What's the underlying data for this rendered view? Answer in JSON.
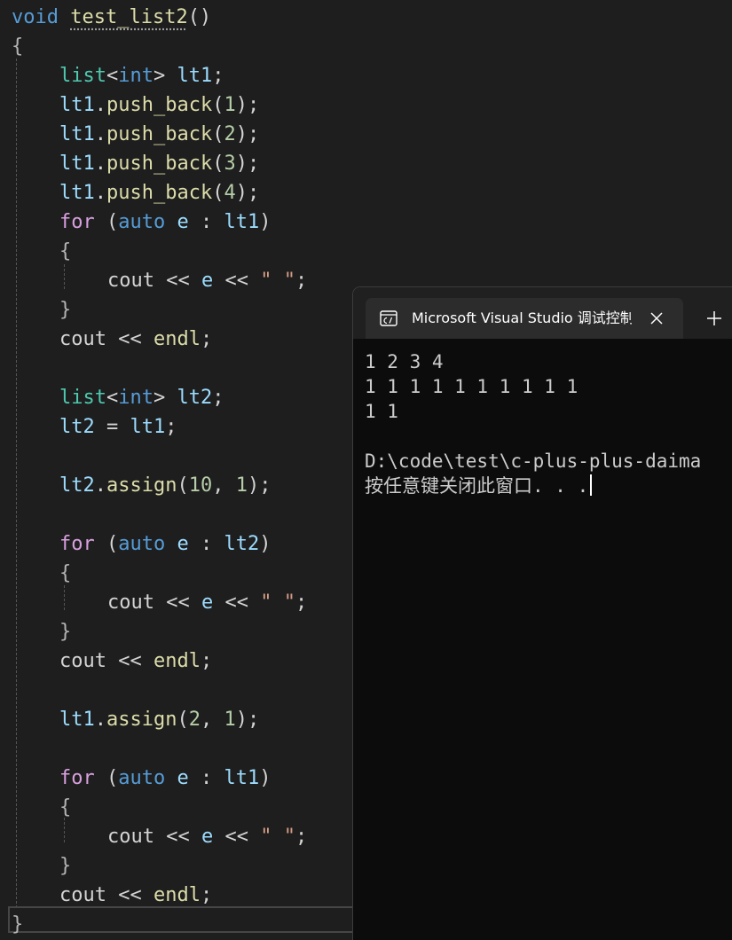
{
  "code": {
    "lines": [
      {
        "indent": 0,
        "tokens": [
          {
            "t": "void",
            "c": "kw"
          },
          {
            "t": " ",
            "c": "punc"
          },
          {
            "t": "test_list2",
            "c": "fn",
            "d": true
          },
          {
            "t": "()",
            "c": "punc"
          }
        ]
      },
      {
        "indent": 0,
        "tokens": [
          {
            "t": "{",
            "c": "brace"
          }
        ]
      },
      {
        "indent": 1,
        "tokens": [
          {
            "t": "list",
            "c": "type"
          },
          {
            "t": "<",
            "c": "punc"
          },
          {
            "t": "int",
            "c": "kw"
          },
          {
            "t": ">",
            "c": "punc"
          },
          {
            "t": " lt1",
            "c": "var"
          },
          {
            "t": ";",
            "c": "punc"
          }
        ]
      },
      {
        "indent": 1,
        "tokens": [
          {
            "t": "lt1",
            "c": "var"
          },
          {
            "t": ".",
            "c": "punc"
          },
          {
            "t": "push_back",
            "c": "fn"
          },
          {
            "t": "(",
            "c": "punc"
          },
          {
            "t": "1",
            "c": "num"
          },
          {
            "t": ");",
            "c": "punc"
          }
        ]
      },
      {
        "indent": 1,
        "tokens": [
          {
            "t": "lt1",
            "c": "var"
          },
          {
            "t": ".",
            "c": "punc"
          },
          {
            "t": "push_back",
            "c": "fn"
          },
          {
            "t": "(",
            "c": "punc"
          },
          {
            "t": "2",
            "c": "num"
          },
          {
            "t": ");",
            "c": "punc"
          }
        ]
      },
      {
        "indent": 1,
        "tokens": [
          {
            "t": "lt1",
            "c": "var"
          },
          {
            "t": ".",
            "c": "punc"
          },
          {
            "t": "push_back",
            "c": "fn"
          },
          {
            "t": "(",
            "c": "punc"
          },
          {
            "t": "3",
            "c": "num"
          },
          {
            "t": ");",
            "c": "punc"
          }
        ]
      },
      {
        "indent": 1,
        "tokens": [
          {
            "t": "lt1",
            "c": "var"
          },
          {
            "t": ".",
            "c": "punc"
          },
          {
            "t": "push_back",
            "c": "fn"
          },
          {
            "t": "(",
            "c": "punc"
          },
          {
            "t": "4",
            "c": "num"
          },
          {
            "t": ");",
            "c": "punc"
          }
        ]
      },
      {
        "indent": 1,
        "tokens": [
          {
            "t": "for",
            "c": "flow"
          },
          {
            "t": " (",
            "c": "punc"
          },
          {
            "t": "auto",
            "c": "kw"
          },
          {
            "t": " e ",
            "c": "var"
          },
          {
            "t": ": ",
            "c": "punc"
          },
          {
            "t": "lt1",
            "c": "var"
          },
          {
            "t": ")",
            "c": "punc"
          }
        ]
      },
      {
        "indent": 1,
        "tokens": [
          {
            "t": "{",
            "c": "brace"
          }
        ]
      },
      {
        "indent": 2,
        "tokens": [
          {
            "t": "cout",
            "c": "punc"
          },
          {
            "t": " << ",
            "c": "punc"
          },
          {
            "t": "e",
            "c": "var"
          },
          {
            "t": " << ",
            "c": "punc"
          },
          {
            "t": "\" \"",
            "c": "str"
          },
          {
            "t": ";",
            "c": "punc"
          }
        ]
      },
      {
        "indent": 1,
        "tokens": [
          {
            "t": "}",
            "c": "brace"
          }
        ]
      },
      {
        "indent": 1,
        "tokens": [
          {
            "t": "cout",
            "c": "punc"
          },
          {
            "t": " << ",
            "c": "punc"
          },
          {
            "t": "endl",
            "c": "fn"
          },
          {
            "t": ";",
            "c": "punc"
          }
        ]
      },
      {
        "indent": 0,
        "tokens": []
      },
      {
        "indent": 1,
        "tokens": [
          {
            "t": "list",
            "c": "type"
          },
          {
            "t": "<",
            "c": "punc"
          },
          {
            "t": "int",
            "c": "kw"
          },
          {
            "t": ">",
            "c": "punc"
          },
          {
            "t": " lt2",
            "c": "var"
          },
          {
            "t": ";",
            "c": "punc"
          }
        ]
      },
      {
        "indent": 1,
        "tokens": [
          {
            "t": "lt2",
            "c": "var"
          },
          {
            "t": " = ",
            "c": "punc"
          },
          {
            "t": "lt1",
            "c": "var"
          },
          {
            "t": ";",
            "c": "punc"
          }
        ]
      },
      {
        "indent": 0,
        "tokens": []
      },
      {
        "indent": 1,
        "tokens": [
          {
            "t": "lt2",
            "c": "var"
          },
          {
            "t": ".",
            "c": "punc"
          },
          {
            "t": "assign",
            "c": "fn"
          },
          {
            "t": "(",
            "c": "punc"
          },
          {
            "t": "10",
            "c": "num"
          },
          {
            "t": ", ",
            "c": "punc"
          },
          {
            "t": "1",
            "c": "num"
          },
          {
            "t": ");",
            "c": "punc"
          }
        ]
      },
      {
        "indent": 0,
        "tokens": []
      },
      {
        "indent": 1,
        "tokens": [
          {
            "t": "for",
            "c": "flow"
          },
          {
            "t": " (",
            "c": "punc"
          },
          {
            "t": "auto",
            "c": "kw"
          },
          {
            "t": " e ",
            "c": "var"
          },
          {
            "t": ": ",
            "c": "punc"
          },
          {
            "t": "lt2",
            "c": "var"
          },
          {
            "t": ")",
            "c": "punc"
          }
        ]
      },
      {
        "indent": 1,
        "tokens": [
          {
            "t": "{",
            "c": "brace"
          }
        ]
      },
      {
        "indent": 2,
        "tokens": [
          {
            "t": "cout",
            "c": "punc"
          },
          {
            "t": " << ",
            "c": "punc"
          },
          {
            "t": "e",
            "c": "var"
          },
          {
            "t": " << ",
            "c": "punc"
          },
          {
            "t": "\" \"",
            "c": "str"
          },
          {
            "t": ";",
            "c": "punc"
          }
        ]
      },
      {
        "indent": 1,
        "tokens": [
          {
            "t": "}",
            "c": "brace"
          }
        ]
      },
      {
        "indent": 1,
        "tokens": [
          {
            "t": "cout",
            "c": "punc"
          },
          {
            "t": " << ",
            "c": "punc"
          },
          {
            "t": "endl",
            "c": "fn"
          },
          {
            "t": ";",
            "c": "punc"
          }
        ]
      },
      {
        "indent": 0,
        "tokens": []
      },
      {
        "indent": 1,
        "tokens": [
          {
            "t": "lt1",
            "c": "var"
          },
          {
            "t": ".",
            "c": "punc"
          },
          {
            "t": "assign",
            "c": "fn"
          },
          {
            "t": "(",
            "c": "punc"
          },
          {
            "t": "2",
            "c": "num"
          },
          {
            "t": ", ",
            "c": "punc"
          },
          {
            "t": "1",
            "c": "num"
          },
          {
            "t": ");",
            "c": "punc"
          }
        ]
      },
      {
        "indent": 0,
        "tokens": []
      },
      {
        "indent": 1,
        "tokens": [
          {
            "t": "for",
            "c": "flow"
          },
          {
            "t": " (",
            "c": "punc"
          },
          {
            "t": "auto",
            "c": "kw"
          },
          {
            "t": " e ",
            "c": "var"
          },
          {
            "t": ": ",
            "c": "punc"
          },
          {
            "t": "lt1",
            "c": "var"
          },
          {
            "t": ")",
            "c": "punc"
          }
        ]
      },
      {
        "indent": 1,
        "tokens": [
          {
            "t": "{",
            "c": "brace"
          }
        ]
      },
      {
        "indent": 2,
        "tokens": [
          {
            "t": "cout",
            "c": "punc"
          },
          {
            "t": " << ",
            "c": "punc"
          },
          {
            "t": "e",
            "c": "var"
          },
          {
            "t": " << ",
            "c": "punc"
          },
          {
            "t": "\" \"",
            "c": "str"
          },
          {
            "t": ";",
            "c": "punc"
          }
        ]
      },
      {
        "indent": 1,
        "tokens": [
          {
            "t": "}",
            "c": "brace"
          }
        ]
      },
      {
        "indent": 1,
        "tokens": [
          {
            "t": "cout",
            "c": "punc"
          },
          {
            "t": " << ",
            "c": "punc"
          },
          {
            "t": "endl",
            "c": "fn"
          },
          {
            "t": ";",
            "c": "punc"
          }
        ]
      },
      {
        "indent": 0,
        "tokens": [
          {
            "t": "}",
            "c": "brace"
          }
        ]
      }
    ]
  },
  "terminal": {
    "tab_title": "Microsoft Visual Studio 调试控制台",
    "tab_icon": "console-icon",
    "close_icon": "close-icon",
    "new_tab_icon": "plus-icon",
    "output": [
      "1 2 3 4",
      "1 1 1 1 1 1 1 1 1 1",
      "1 1",
      "",
      "D:\\code\\test\\c-plus-plus-daima",
      "按任意键关闭此窗口. . ."
    ]
  },
  "colors": {
    "editor_bg": "#1e1e1e",
    "keyword": "#569cd6",
    "control_flow": "#d8a0df",
    "type": "#4ec9b0",
    "variable": "#9cdcfe",
    "function": "#dcdcaa",
    "number": "#b5cea8",
    "string": "#d69d85",
    "terminal_bg": "#0c0c0c"
  }
}
